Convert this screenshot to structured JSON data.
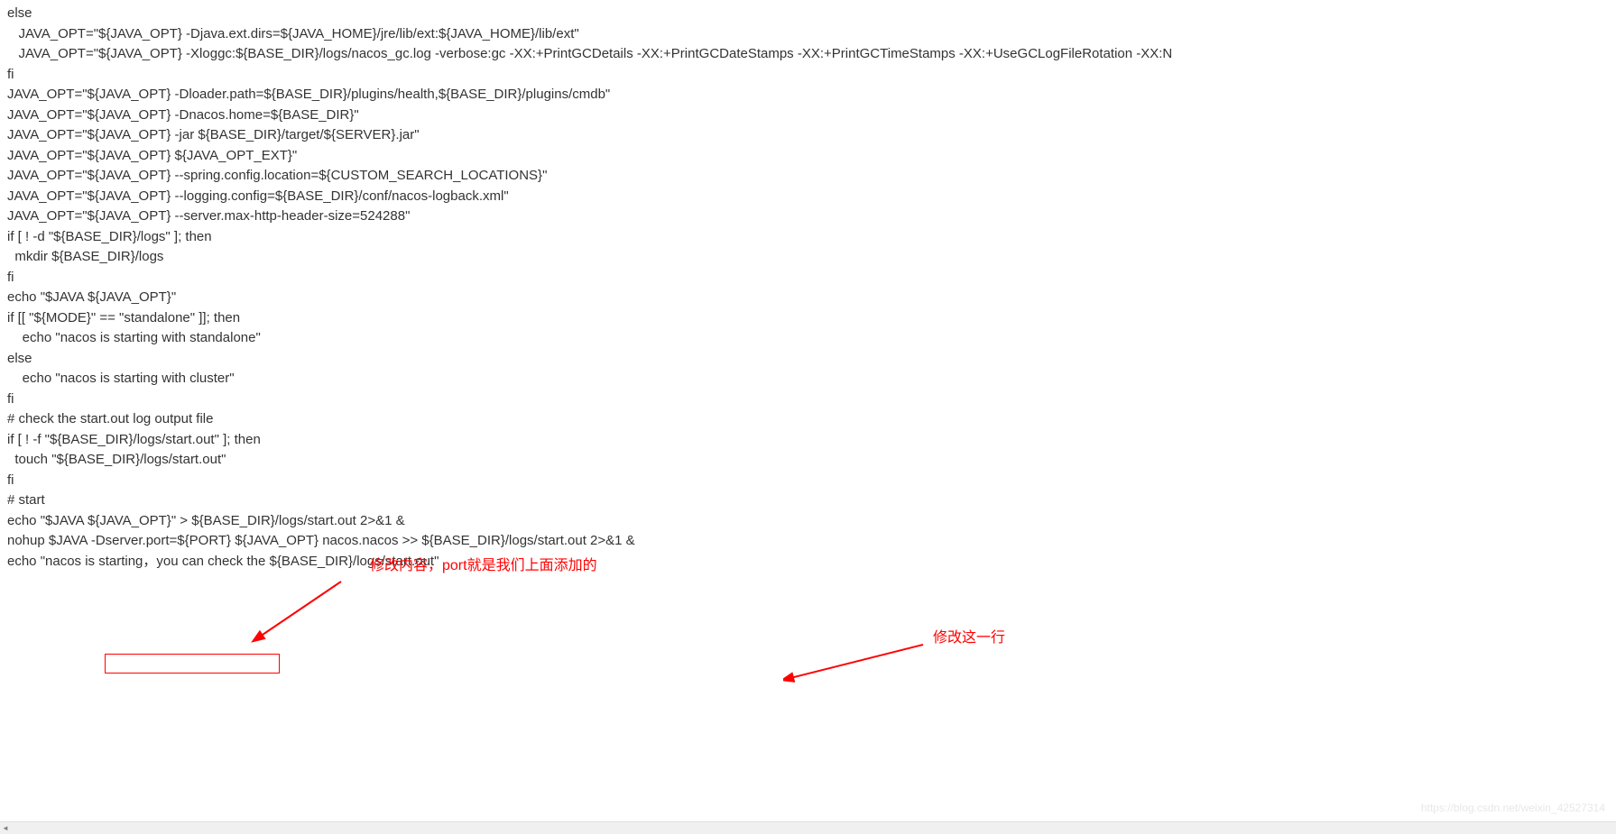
{
  "code": {
    "lines": [
      "else",
      "   JAVA_OPT=\"${JAVA_OPT} -Djava.ext.dirs=${JAVA_HOME}/jre/lib/ext:${JAVA_HOME}/lib/ext\"",
      "   JAVA_OPT=\"${JAVA_OPT} -Xloggc:${BASE_DIR}/logs/nacos_gc.log -verbose:gc -XX:+PrintGCDetails -XX:+PrintGCDateStamps -XX:+PrintGCTimeStamps -XX:+UseGCLogFileRotation -XX:N",
      "fi",
      "",
      "JAVA_OPT=\"${JAVA_OPT} -Dloader.path=${BASE_DIR}/plugins/health,${BASE_DIR}/plugins/cmdb\"",
      "JAVA_OPT=\"${JAVA_OPT} -Dnacos.home=${BASE_DIR}\"",
      "JAVA_OPT=\"${JAVA_OPT} -jar ${BASE_DIR}/target/${SERVER}.jar\"",
      "JAVA_OPT=\"${JAVA_OPT} ${JAVA_OPT_EXT}\"",
      "JAVA_OPT=\"${JAVA_OPT} --spring.config.location=${CUSTOM_SEARCH_LOCATIONS}\"",
      "JAVA_OPT=\"${JAVA_OPT} --logging.config=${BASE_DIR}/conf/nacos-logback.xml\"",
      "JAVA_OPT=\"${JAVA_OPT} --server.max-http-header-size=524288\"",
      "",
      "if [ ! -d \"${BASE_DIR}/logs\" ]; then",
      "  mkdir ${BASE_DIR}/logs",
      "fi",
      "",
      "echo \"$JAVA ${JAVA_OPT}\"",
      "",
      "if [[ \"${MODE}\" == \"standalone\" ]]; then",
      "    echo \"nacos is starting with standalone\"",
      "else",
      "    echo \"nacos is starting with cluster\"",
      "fi",
      "",
      "# check the start.out log output file",
      "if [ ! -f \"${BASE_DIR}/logs/start.out\" ]; then",
      "  touch \"${BASE_DIR}/logs/start.out\"",
      "fi",
      "# start",
      "echo \"$JAVA ${JAVA_OPT}\" > ${BASE_DIR}/logs/start.out 2>&1 &",
      "nohup $JAVA -Dserver.port=${PORT} ${JAVA_OPT} nacos.nacos >> ${BASE_DIR}/logs/start.out 2>&1 &",
      "echo \"nacos is starting，you can check the ${BASE_DIR}/logs/start.out\""
    ]
  },
  "annotations": {
    "label1": "修改内容，port就是我们上面添加的",
    "label2": "修改这一行"
  },
  "watermark": "https://blog.csdn.net/weixin_42527314"
}
